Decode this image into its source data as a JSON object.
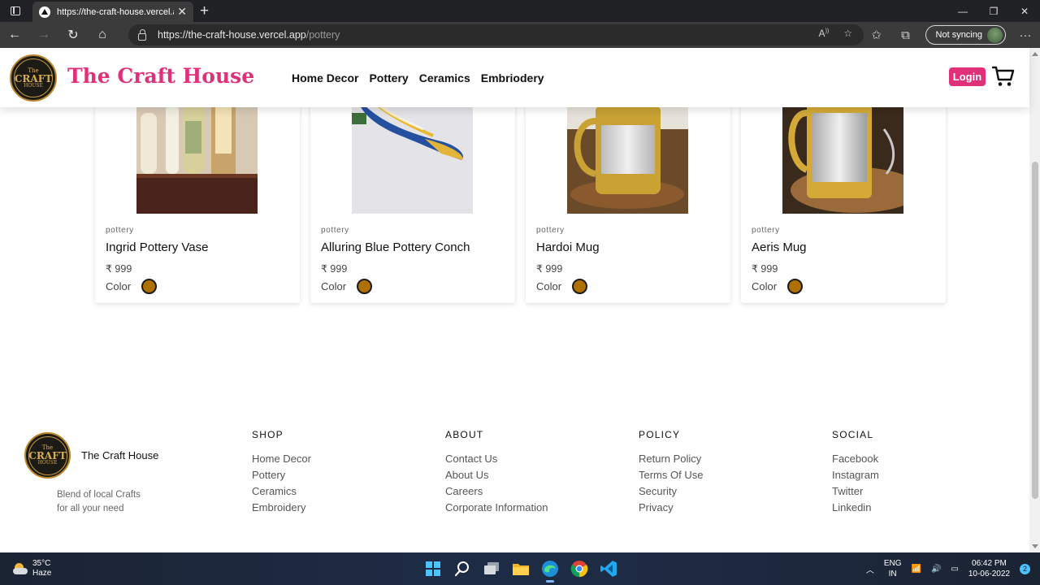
{
  "browser": {
    "tab_title": "https://the-craft-house.vercel.app/",
    "url_host": "https://the-craft-house.vercel.app",
    "url_path": "/pottery",
    "sync_label": "Not syncing"
  },
  "site": {
    "brand": "The Craft House",
    "logo_lines": [
      "The",
      "CRAFT",
      "HOUSE"
    ],
    "nav": [
      "Home Decor",
      "Pottery",
      "Ceramics",
      "Embriodery"
    ],
    "login_label": "Login",
    "accent_color": "#e0307a"
  },
  "products": [
    {
      "category": "pottery",
      "name": "Ingrid Pottery Vase",
      "price": "₹ 999",
      "color_label": "Color",
      "swatch": "#b07000"
    },
    {
      "category": "pottery",
      "name": "Alluring Blue Pottery Conch",
      "price": "₹ 999",
      "color_label": "Color",
      "swatch": "#b07000"
    },
    {
      "category": "pottery",
      "name": "Hardoi Mug",
      "price": "₹ 999",
      "color_label": "Color",
      "swatch": "#b07000"
    },
    {
      "category": "pottery",
      "name": "Aeris Mug",
      "price": "₹ 999",
      "color_label": "Color",
      "swatch": "#b07000"
    }
  ],
  "footer": {
    "brand": "The Craft House",
    "tagline_1": "Blend of local Crafts",
    "tagline_2": "for all your need",
    "columns": [
      {
        "heading": "SHOP",
        "links": [
          "Home Decor",
          "Pottery",
          "Ceramics",
          "Embroidery"
        ]
      },
      {
        "heading": "ABOUT",
        "links": [
          "Contact Us",
          "About Us",
          "Careers",
          "Corporate Information"
        ]
      },
      {
        "heading": "POLICY",
        "links": [
          "Return Policy",
          "Terms Of Use",
          "Security",
          "Privacy"
        ]
      },
      {
        "heading": "SOCIAL",
        "links": [
          "Facebook",
          "Instagram",
          "Twitter",
          "Linkedin"
        ]
      }
    ]
  },
  "taskbar": {
    "temperature": "35°C",
    "weather": "Haze",
    "lang_1": "ENG",
    "lang_2": "IN",
    "time": "06:42 PM",
    "date": "10-06-2022",
    "notifications": "2"
  }
}
